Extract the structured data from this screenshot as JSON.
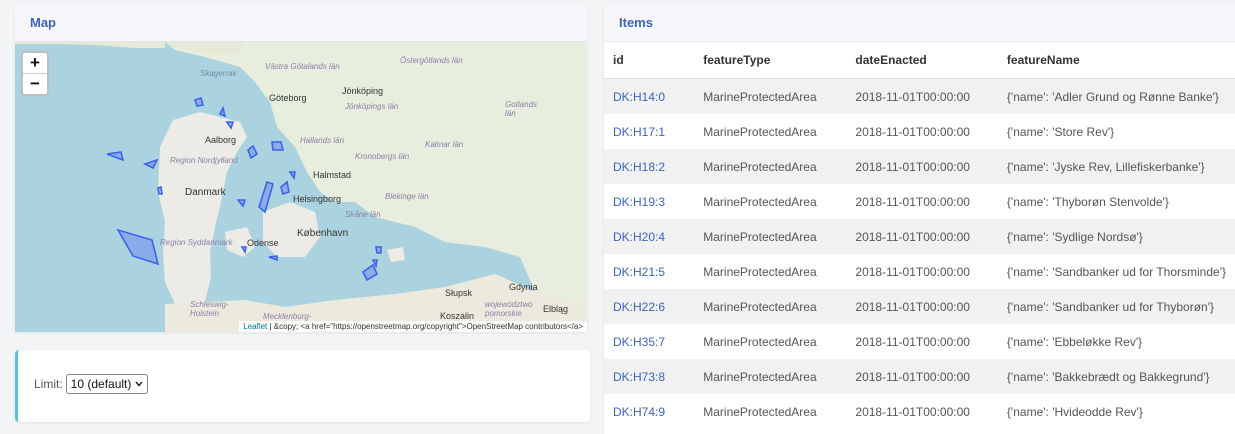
{
  "map": {
    "header": "Map",
    "zoom_in": "+",
    "zoom_out": "−",
    "attribution_link": "Leaflet",
    "attribution_text": " | &copy; <a href=\"https://openstreetmap.org/copyright\">OpenStreetMap contributors</a>",
    "labels": {
      "skagerrak": "Skagerrak",
      "goteborg": "Göteborg",
      "jonkoping": "Jönköping",
      "aalborg": "Aalborg",
      "halmstad": "Halmstad",
      "danmark": "Danmark",
      "helsingborg": "Helsingborg",
      "kobenhavn": "København",
      "odense": "Odense",
      "slupsk": "Słupsk",
      "gdynia": "Gdynia",
      "koszalin": "Koszalin",
      "elblag": "Elbląg",
      "vastra": "Västra Götalands län",
      "ostergotland": "Östergötlands län",
      "gotlands": "Gotlands län",
      "jonkopings": "Jönköpings län",
      "hallands": "Hallands län",
      "kronobergs": "Kronobergs län",
      "kalmar": "Kalmar län",
      "blekinge": "Blekinge län",
      "skane": "Skåne län",
      "nordjylland": "Region Nordjylland",
      "syddanmark": "Region Syddanmark",
      "schleswig": "Schleswig-Holstein",
      "mecklenburg": "Mecklenburg-",
      "pomorskie": "województwo pomorskie"
    }
  },
  "limit": {
    "label": "Limit:",
    "selected": "10 (default)"
  },
  "items": {
    "header": "Items",
    "columns": [
      "id",
      "featureType",
      "dateEnacted",
      "featureName"
    ],
    "rows": [
      [
        "DK:H14:0",
        "MarineProtectedArea",
        "2018-11-01T00:00:00",
        "{'name': 'Adler Grund og Rønne Banke'}"
      ],
      [
        "DK:H17:1",
        "MarineProtectedArea",
        "2018-11-01T00:00:00",
        "{'name': 'Store Rev'}"
      ],
      [
        "DK:H18:2",
        "MarineProtectedArea",
        "2018-11-01T00:00:00",
        "{'name': 'Jyske Rev, Lillefiskerbanke'}"
      ],
      [
        "DK:H19:3",
        "MarineProtectedArea",
        "2018-11-01T00:00:00",
        "{'name': 'Thyborøn Stenvolde'}"
      ],
      [
        "DK:H20:4",
        "MarineProtectedArea",
        "2018-11-01T00:00:00",
        "{'name': 'Sydlige Nordsø'}"
      ],
      [
        "DK:H21:5",
        "MarineProtectedArea",
        "2018-11-01T00:00:00",
        "{'name': 'Sandbanker ud for Thorsminde'}"
      ],
      [
        "DK:H22:6",
        "MarineProtectedArea",
        "2018-11-01T00:00:00",
        "{'name': 'Sandbanker ud for Thyborøn'}"
      ],
      [
        "DK:H35:7",
        "MarineProtectedArea",
        "2018-11-01T00:00:00",
        "{'name': 'Ebbeløkke Rev'}"
      ],
      [
        "DK:H73:8",
        "MarineProtectedArea",
        "2018-11-01T00:00:00",
        "{'name': 'Bakkebrædt og Bakkegrund'}"
      ],
      [
        "DK:H74:9",
        "MarineProtectedArea",
        "2018-11-01T00:00:00",
        "{'name': 'Hvideodde Rev'}"
      ]
    ]
  }
}
